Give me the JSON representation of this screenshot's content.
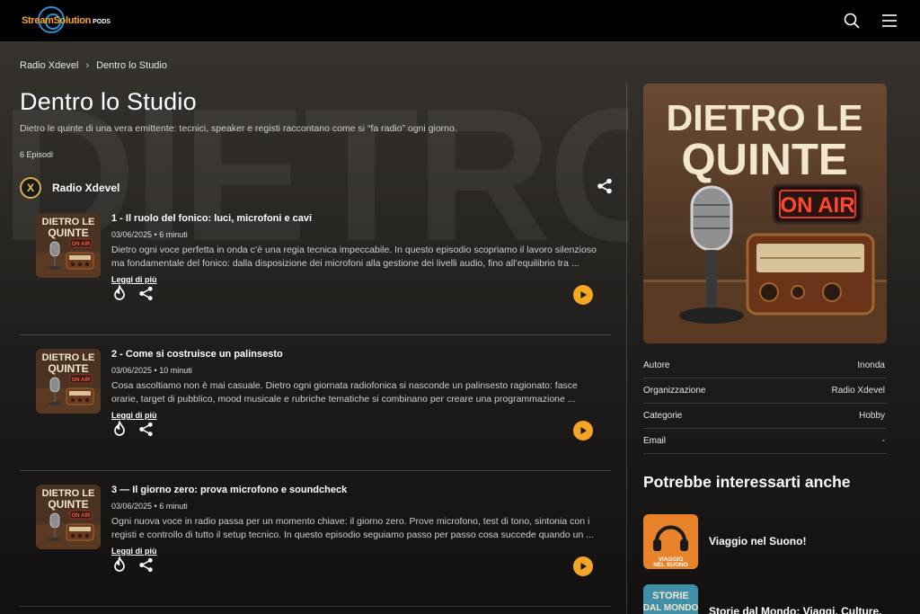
{
  "brand": {
    "name": "StreamSolution",
    "sub": "PODS"
  },
  "breadcrumb": {
    "parent": "Radio Xdevel",
    "separator": "›",
    "current": "Dentro lo Studio"
  },
  "podcast": {
    "title": "Dentro lo Studio",
    "description": "Dietro le quinte di una vera emittente: tecnici, speaker e registi raccontano come si “fa radio” ogni giorno.",
    "episode_count": "6 Episodi",
    "author": "Radio Xdevel",
    "author_initial": "X",
    "watermark": "DIETRO LE QUINTE"
  },
  "cover_art": {
    "line1": "DIETRO LE",
    "line2": "QUINTE",
    "badge": "ON AIR"
  },
  "episodes": [
    {
      "title": "1 - Il ruolo del fonico: luci, microfoni e cavi",
      "meta": "03/06/2025 • 6 minuti",
      "text": "Dietro ogni voce perfetta in onda c’è una regia tecnica impeccabile. In questo episodio scopriamo il lavoro silenzioso ma fondamentale del fonico: dalla disposizione dei microfoni alla gestione dei livelli audio, fino all’equilibrio tra ...",
      "more": "Leggi di più"
    },
    {
      "title": "2 - Come si costruisce un palinsesto",
      "meta": "03/06/2025 • 10 minuti",
      "text": "Cosa ascoltiamo non è mai casuale. Dietro ogni giornata radiofonica si nasconde un palinsesto ragionato: fasce orarie, target di pubblico, mood musicale e rubriche tematiche si combinano per creare una programmazione ...",
      "more": "Leggi di più"
    },
    {
      "title": "3 — Il giorno zero: prova microfono e soundcheck",
      "meta": "03/06/2025 • 6 minuti",
      "text": "Ogni nuova voce in radio passa per un momento chiave: il giorno zero. Prove microfono, test di tono, sintonia con i registi e controllo di tutto il setup tecnico. In questo episodio seguiamo passo per passo cosa succede quando un ...",
      "more": "Leggi di più"
    }
  ],
  "info": [
    {
      "label": "Autore",
      "value": "Inonda"
    },
    {
      "label": "Organizzazione",
      "value": "Radio Xdevel"
    },
    {
      "label": "Categorie",
      "value": "Hobby"
    },
    {
      "label": "Email",
      "value": "-"
    }
  ],
  "related": {
    "heading": "Potrebbe interessarti anche",
    "items": [
      {
        "title": "Viaggio nel Suono!",
        "thumb_text": "VIAGGIO NEL SUONO"
      },
      {
        "title": "Storie dal Mondo: Viaggi, Culture,",
        "thumb_text": "STORIE DAL MONDO"
      }
    ]
  },
  "colors": {
    "accent": "#f5a524",
    "brand_blue": "#2b8fd6",
    "topbar": "#000000"
  }
}
